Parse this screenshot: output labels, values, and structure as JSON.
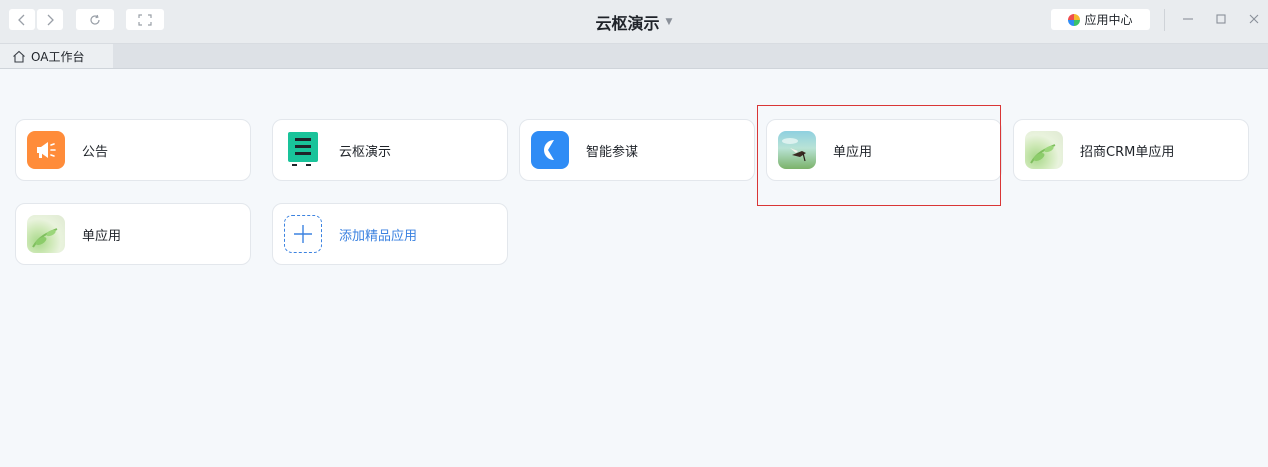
{
  "window": {
    "title": "云枢演示",
    "app_center_label": "应用中心"
  },
  "tabs": [
    {
      "label": "OA工作台"
    }
  ],
  "apps": [
    {
      "label": "公告",
      "icon": "megaphone-icon",
      "color": "#ff8c3a"
    },
    {
      "label": "云枢演示",
      "icon": "yunshu-logo-icon",
      "color": "#19c39a"
    },
    {
      "label": "智能参谋",
      "icon": "smart-advisor-icon",
      "color": "#2f8cf5"
    },
    {
      "label": "单应用",
      "icon": "bird-photo-icon",
      "color": "#7ec9c2"
    },
    {
      "label": "招商CRM单应用",
      "icon": "leaf-photo-icon",
      "color": "#a8d88a"
    },
    {
      "label": "单应用",
      "icon": "leaf-photo-icon",
      "color": "#a8d88a"
    }
  ],
  "add_app": {
    "label": "添加精品应用",
    "color": "#3b82e0"
  },
  "colors": {
    "highlight": "#d93636",
    "background": "#f5f8fb"
  }
}
